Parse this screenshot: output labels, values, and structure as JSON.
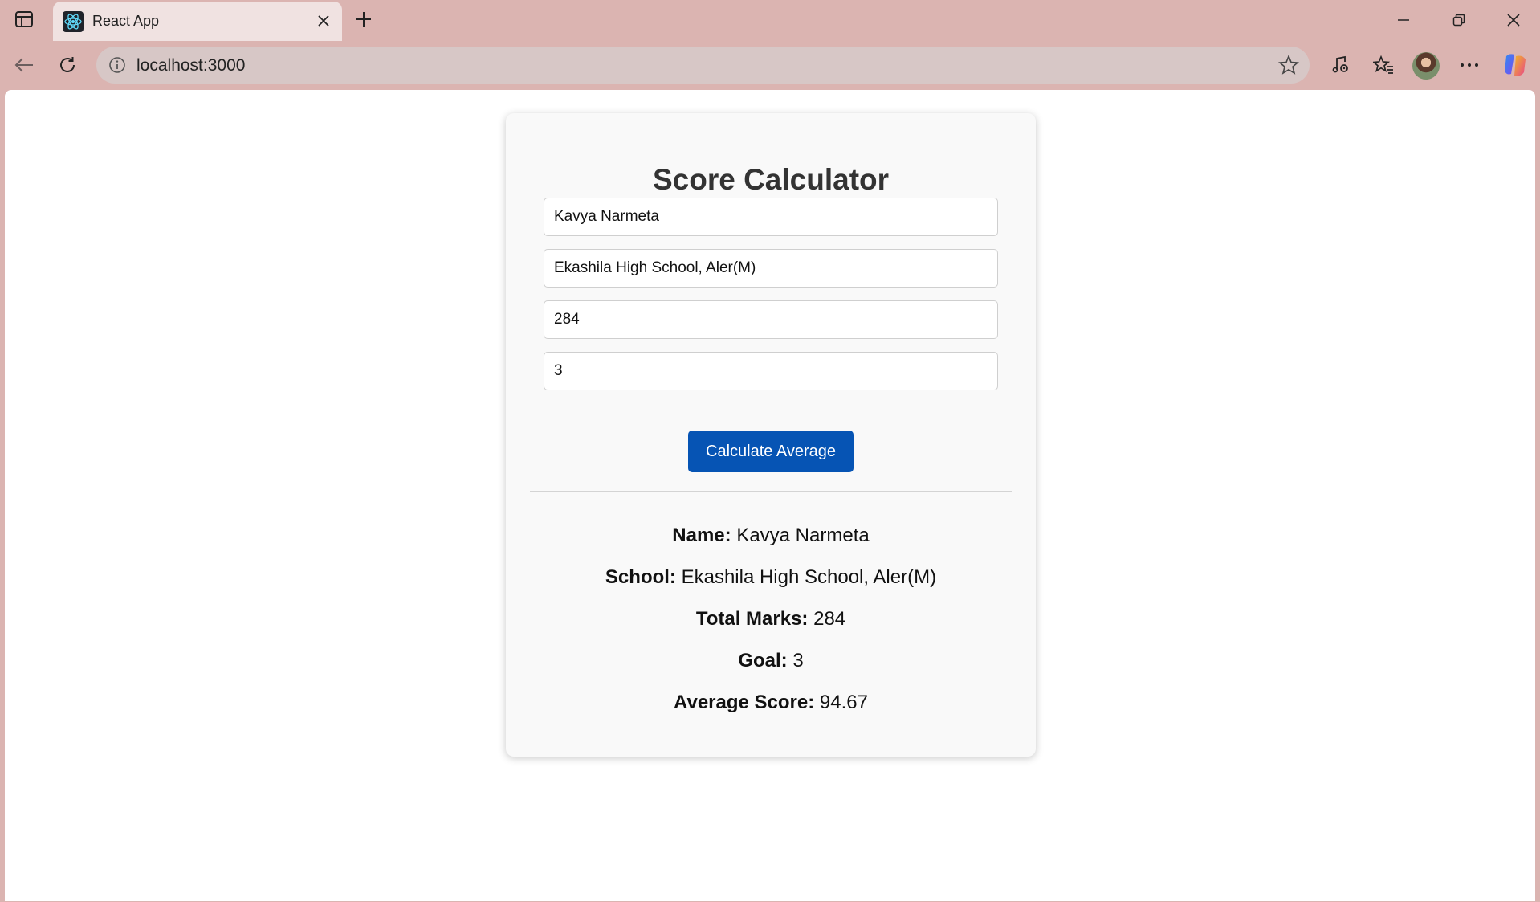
{
  "browser": {
    "tab": {
      "title": "React App"
    },
    "address": {
      "url": "localhost:3000"
    },
    "colors": {
      "chrome": "#dbb4b1",
      "active_tab": "#f0e2e1",
      "address_bar": "#d7c7c6",
      "accent": "#0654b4"
    }
  },
  "app": {
    "title": "Score Calculator",
    "inputs": {
      "name": "Kavya Narmeta",
      "school": "Ekashila High School, Aler(M)",
      "total_marks": "284",
      "goal": "3"
    },
    "button_label": "Calculate Average",
    "results": [
      {
        "label": "Name:",
        "value": "Kavya Narmeta"
      },
      {
        "label": "School:",
        "value": "Ekashila High School, Aler(M)"
      },
      {
        "label": "Total Marks:",
        "value": "284"
      },
      {
        "label": "Goal:",
        "value": "3"
      },
      {
        "label": "Average Score:",
        "value": "94.67"
      }
    ]
  }
}
